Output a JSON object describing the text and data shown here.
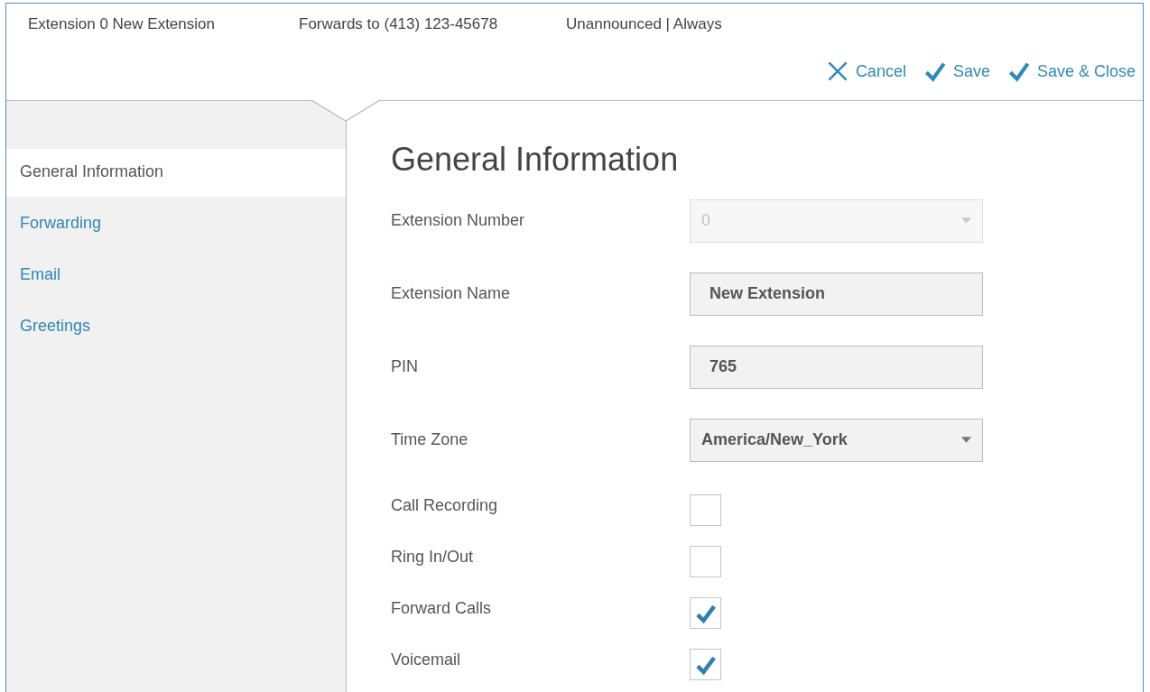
{
  "header": {
    "summary": [
      "Extension 0 New Extension",
      "Forwards to (413) 123-45678",
      "Unannounced | Always"
    ],
    "actions": [
      {
        "kind": "cancel",
        "label": "Cancel"
      },
      {
        "kind": "confirm",
        "label": "Save"
      },
      {
        "kind": "confirm",
        "label": "Save & Close"
      }
    ]
  },
  "sidebar": {
    "items": [
      {
        "label": "General Information",
        "selected": true
      },
      {
        "label": "Forwarding",
        "selected": false
      },
      {
        "label": "Email",
        "selected": false
      },
      {
        "label": "Greetings",
        "selected": false
      }
    ]
  },
  "form": {
    "title": "General Information",
    "fields": [
      {
        "kind": "select",
        "label": "Extension Number",
        "value": "0",
        "disabled": true
      },
      {
        "kind": "text",
        "label": "Extension Name",
        "value": "New Extension",
        "disabled": false
      },
      {
        "kind": "text",
        "label": "PIN",
        "value": "765",
        "disabled": false
      },
      {
        "kind": "select",
        "label": "Time Zone",
        "value": "America/New_York",
        "disabled": false
      },
      {
        "kind": "checkbox",
        "label": "Call Recording",
        "checked": false
      },
      {
        "kind": "checkbox",
        "label": "Ring In/Out",
        "checked": false
      },
      {
        "kind": "checkbox",
        "label": "Forward Calls",
        "checked": true
      },
      {
        "kind": "checkbox",
        "label": "Voicemail",
        "checked": true
      }
    ]
  }
}
